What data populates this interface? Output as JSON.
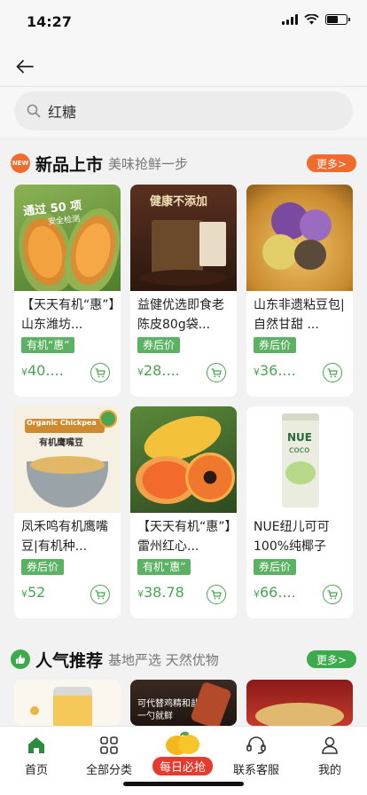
{
  "status": {
    "time": "14:27"
  },
  "search": {
    "value": "红糖"
  },
  "sections": [
    {
      "badge": "NEW",
      "title": "新品上市",
      "subtitle": "美味抢鲜一步",
      "more": "更多>"
    },
    {
      "badge": "",
      "title": "人气推荐",
      "subtitle": "基地严选 天然优物",
      "more": "更多>"
    }
  ],
  "products": [
    {
      "name": "【天天有机“惠”】山东潍坊...",
      "tag": "有机“惠”",
      "currency": "¥",
      "price": "40....",
      "img_text": "通过 50 项",
      "img_text2": "安全检测"
    },
    {
      "name": "益健优选即食老陈皮80g袋...",
      "tag": "券后价",
      "currency": "¥",
      "price": "28....",
      "img_text": "健康不添加",
      "img_text2": ""
    },
    {
      "name": "山东非遗粘豆包|自然甘甜 ...",
      "tag": "券后价",
      "currency": "¥",
      "price": "36....",
      "img_text": "",
      "img_text2": ""
    },
    {
      "name": "凤禾鸣有机鹰嘴豆|有机种...",
      "tag": "券后价",
      "currency": "¥",
      "price": "52",
      "img_text": "Organic Chickpea",
      "img_text2": "有机鹰嘴豆"
    },
    {
      "name": "【天天有机“惠”】雷州红心...",
      "tag": "有机“惠”",
      "currency": "¥",
      "price": "38.78",
      "img_text": "",
      "img_text2": ""
    },
    {
      "name": "NUE纽儿可可100%纯椰子水...",
      "tag": "券后价",
      "currency": "¥",
      "price": "66....",
      "img_text": "NUE",
      "img_text2": "coco"
    }
  ],
  "recommend_images": [
    {
      "img_text": "",
      "img_text2": ""
    },
    {
      "img_text": "可代替鸡精和盐",
      "img_text2": "一勺就鲜"
    },
    {
      "img_text": "",
      "img_text2": ""
    }
  ],
  "tabbar": [
    {
      "label": "首页",
      "icon": "home-icon"
    },
    {
      "label": "全部分类",
      "icon": "grid-icon"
    },
    {
      "label": "每日必抢",
      "icon": "mango-icon"
    },
    {
      "label": "联系客服",
      "icon": "headset-icon"
    },
    {
      "label": "我的",
      "icon": "person-icon"
    }
  ],
  "colors": {
    "accent_green": "#4aa550",
    "tag_green": "#5ab262",
    "more_orange": "#f26b2c",
    "more_green": "#3daa4c"
  }
}
